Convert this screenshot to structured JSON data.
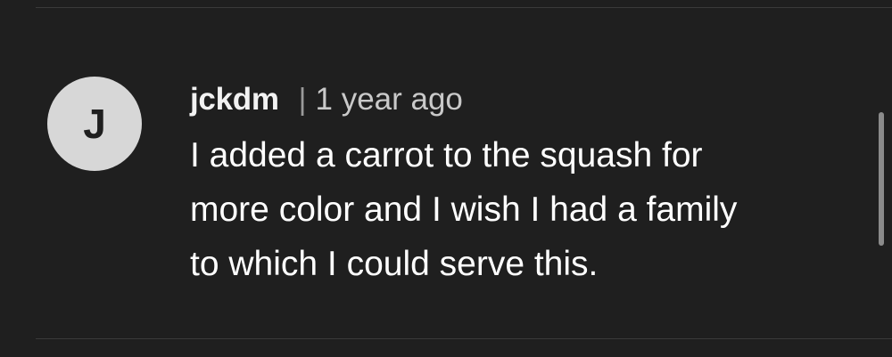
{
  "comment": {
    "avatar_letter": "J",
    "username": "jckdm",
    "separator": "|",
    "timestamp": "1 year ago",
    "text_lines": [
      "I added a carrot to the squash for",
      "more color and I wish I had a family",
      "to which I could serve this."
    ]
  },
  "colors": {
    "background": "#1f1f1f",
    "avatar_bg": "#d7d7d7",
    "text": "#ffffff",
    "muted": "#9a9a9a"
  }
}
